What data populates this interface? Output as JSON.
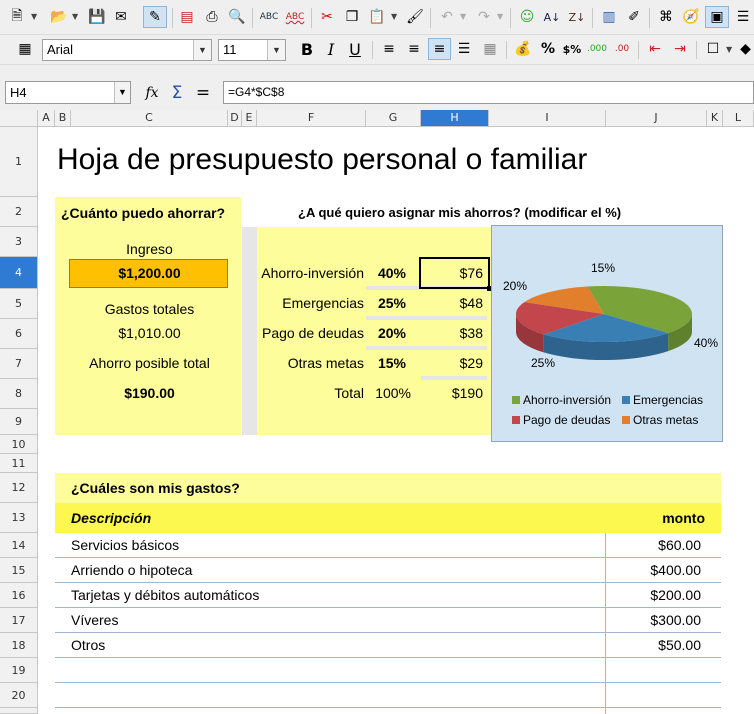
{
  "toolbar": {
    "font_name": "Arial",
    "font_size": "11"
  },
  "formula_bar": {
    "name_box": "H4",
    "formula": "=G4*$C$8"
  },
  "columns": [
    "A",
    "B",
    "C",
    "D",
    "E",
    "F",
    "G",
    "H",
    "I",
    "J",
    "K",
    "L"
  ],
  "active_column": "H",
  "rows": [
    "1",
    "2",
    "3",
    "4",
    "5",
    "6",
    "7",
    "8",
    "9",
    "10",
    "11",
    "12",
    "13",
    "14",
    "15",
    "16",
    "17",
    "18",
    "19",
    "20"
  ],
  "active_row": "4",
  "sheet": {
    "title": "Hoja de presupuesto personal o familiar",
    "left_panel": {
      "heading": "¿Cuánto puedo ahorrar?",
      "income_label": "Ingreso",
      "income_value": "$1,200.00",
      "total_expenses_label": "Gastos totales",
      "total_expenses_value": "$1,010.00",
      "possible_savings_label": "Ahorro posible total",
      "possible_savings_value": "$190.00"
    },
    "allocation": {
      "heading": "¿A qué quiero asignar mis ahorros? (modificar el %)",
      "rows": [
        {
          "label": "Ahorro-inversión",
          "pct": "40%",
          "amount": "$76"
        },
        {
          "label": "Emergencias",
          "pct": "25%",
          "amount": "$48"
        },
        {
          "label": "Pago de deudas",
          "pct": "20%",
          "amount": "$38"
        },
        {
          "label": "Otras metas",
          "pct": "15%",
          "amount": "$29"
        }
      ],
      "total": {
        "label": "Total",
        "pct": "100%",
        "amount": "$190"
      }
    },
    "expenses": {
      "heading": "¿Cuáles son mis gastos?",
      "col_description": "Descripción",
      "col_amount": "monto",
      "rows": [
        {
          "desc": "Servicios básicos",
          "amount": "$60.00"
        },
        {
          "desc": "Arriendo o hipoteca",
          "amount": "$400.00"
        },
        {
          "desc": "Tarjetas y débitos automáticos",
          "amount": "$200.00"
        },
        {
          "desc": "Víveres",
          "amount": "$300.00"
        },
        {
          "desc": "Otros",
          "amount": "$50.00"
        }
      ]
    }
  },
  "chart_data": {
    "type": "pie",
    "title": "",
    "series": [
      {
        "name": "Ahorro-inversión",
        "value": 40,
        "label": "40%",
        "color": "#7aa43a"
      },
      {
        "name": "Emergencias",
        "value": 25,
        "label": "25%",
        "color": "#3a7fb3"
      },
      {
        "name": "Pago de deudas",
        "value": 20,
        "label": "20%",
        "color": "#c2464c"
      },
      {
        "name": "Otras metas",
        "value": 15,
        "label": "15%",
        "color": "#e17f2c"
      }
    ],
    "legend_position": "bottom",
    "background": "#cfe3f3"
  },
  "colors": {
    "panel_yellow": "#fefd9b",
    "header_yellow": "#fdf84f",
    "income_orange": "#fec000",
    "selection_blue": "#2f7ad3"
  }
}
